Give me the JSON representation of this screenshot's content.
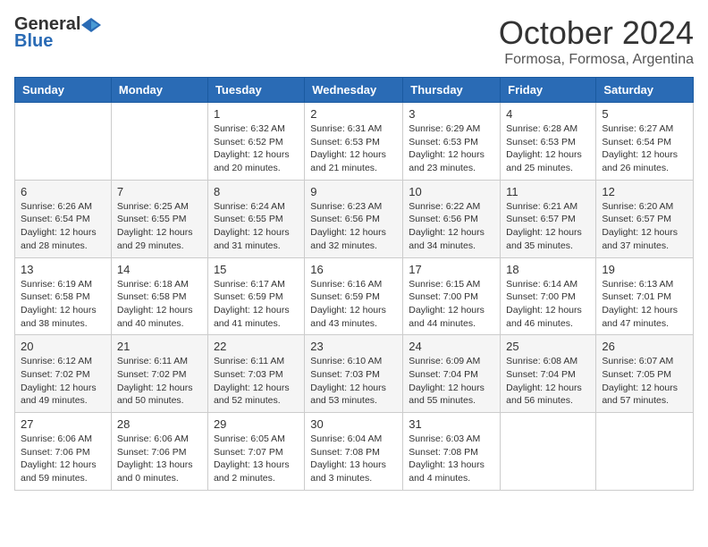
{
  "header": {
    "logo_general": "General",
    "logo_blue": "Blue",
    "month": "October 2024",
    "location": "Formosa, Formosa, Argentina"
  },
  "weekdays": [
    "Sunday",
    "Monday",
    "Tuesday",
    "Wednesday",
    "Thursday",
    "Friday",
    "Saturday"
  ],
  "weeks": [
    [
      {
        "day": "",
        "sunrise": "",
        "sunset": "",
        "daylight": ""
      },
      {
        "day": "",
        "sunrise": "",
        "sunset": "",
        "daylight": ""
      },
      {
        "day": "1",
        "sunrise": "Sunrise: 6:32 AM",
        "sunset": "Sunset: 6:52 PM",
        "daylight": "Daylight: 12 hours and 20 minutes."
      },
      {
        "day": "2",
        "sunrise": "Sunrise: 6:31 AM",
        "sunset": "Sunset: 6:53 PM",
        "daylight": "Daylight: 12 hours and 21 minutes."
      },
      {
        "day": "3",
        "sunrise": "Sunrise: 6:29 AM",
        "sunset": "Sunset: 6:53 PM",
        "daylight": "Daylight: 12 hours and 23 minutes."
      },
      {
        "day": "4",
        "sunrise": "Sunrise: 6:28 AM",
        "sunset": "Sunset: 6:53 PM",
        "daylight": "Daylight: 12 hours and 25 minutes."
      },
      {
        "day": "5",
        "sunrise": "Sunrise: 6:27 AM",
        "sunset": "Sunset: 6:54 PM",
        "daylight": "Daylight: 12 hours and 26 minutes."
      }
    ],
    [
      {
        "day": "6",
        "sunrise": "Sunrise: 6:26 AM",
        "sunset": "Sunset: 6:54 PM",
        "daylight": "Daylight: 12 hours and 28 minutes."
      },
      {
        "day": "7",
        "sunrise": "Sunrise: 6:25 AM",
        "sunset": "Sunset: 6:55 PM",
        "daylight": "Daylight: 12 hours and 29 minutes."
      },
      {
        "day": "8",
        "sunrise": "Sunrise: 6:24 AM",
        "sunset": "Sunset: 6:55 PM",
        "daylight": "Daylight: 12 hours and 31 minutes."
      },
      {
        "day": "9",
        "sunrise": "Sunrise: 6:23 AM",
        "sunset": "Sunset: 6:56 PM",
        "daylight": "Daylight: 12 hours and 32 minutes."
      },
      {
        "day": "10",
        "sunrise": "Sunrise: 6:22 AM",
        "sunset": "Sunset: 6:56 PM",
        "daylight": "Daylight: 12 hours and 34 minutes."
      },
      {
        "day": "11",
        "sunrise": "Sunrise: 6:21 AM",
        "sunset": "Sunset: 6:57 PM",
        "daylight": "Daylight: 12 hours and 35 minutes."
      },
      {
        "day": "12",
        "sunrise": "Sunrise: 6:20 AM",
        "sunset": "Sunset: 6:57 PM",
        "daylight": "Daylight: 12 hours and 37 minutes."
      }
    ],
    [
      {
        "day": "13",
        "sunrise": "Sunrise: 6:19 AM",
        "sunset": "Sunset: 6:58 PM",
        "daylight": "Daylight: 12 hours and 38 minutes."
      },
      {
        "day": "14",
        "sunrise": "Sunrise: 6:18 AM",
        "sunset": "Sunset: 6:58 PM",
        "daylight": "Daylight: 12 hours and 40 minutes."
      },
      {
        "day": "15",
        "sunrise": "Sunrise: 6:17 AM",
        "sunset": "Sunset: 6:59 PM",
        "daylight": "Daylight: 12 hours and 41 minutes."
      },
      {
        "day": "16",
        "sunrise": "Sunrise: 6:16 AM",
        "sunset": "Sunset: 6:59 PM",
        "daylight": "Daylight: 12 hours and 43 minutes."
      },
      {
        "day": "17",
        "sunrise": "Sunrise: 6:15 AM",
        "sunset": "Sunset: 7:00 PM",
        "daylight": "Daylight: 12 hours and 44 minutes."
      },
      {
        "day": "18",
        "sunrise": "Sunrise: 6:14 AM",
        "sunset": "Sunset: 7:00 PM",
        "daylight": "Daylight: 12 hours and 46 minutes."
      },
      {
        "day": "19",
        "sunrise": "Sunrise: 6:13 AM",
        "sunset": "Sunset: 7:01 PM",
        "daylight": "Daylight: 12 hours and 47 minutes."
      }
    ],
    [
      {
        "day": "20",
        "sunrise": "Sunrise: 6:12 AM",
        "sunset": "Sunset: 7:02 PM",
        "daylight": "Daylight: 12 hours and 49 minutes."
      },
      {
        "day": "21",
        "sunrise": "Sunrise: 6:11 AM",
        "sunset": "Sunset: 7:02 PM",
        "daylight": "Daylight: 12 hours and 50 minutes."
      },
      {
        "day": "22",
        "sunrise": "Sunrise: 6:11 AM",
        "sunset": "Sunset: 7:03 PM",
        "daylight": "Daylight: 12 hours and 52 minutes."
      },
      {
        "day": "23",
        "sunrise": "Sunrise: 6:10 AM",
        "sunset": "Sunset: 7:03 PM",
        "daylight": "Daylight: 12 hours and 53 minutes."
      },
      {
        "day": "24",
        "sunrise": "Sunrise: 6:09 AM",
        "sunset": "Sunset: 7:04 PM",
        "daylight": "Daylight: 12 hours and 55 minutes."
      },
      {
        "day": "25",
        "sunrise": "Sunrise: 6:08 AM",
        "sunset": "Sunset: 7:04 PM",
        "daylight": "Daylight: 12 hours and 56 minutes."
      },
      {
        "day": "26",
        "sunrise": "Sunrise: 6:07 AM",
        "sunset": "Sunset: 7:05 PM",
        "daylight": "Daylight: 12 hours and 57 minutes."
      }
    ],
    [
      {
        "day": "27",
        "sunrise": "Sunrise: 6:06 AM",
        "sunset": "Sunset: 7:06 PM",
        "daylight": "Daylight: 12 hours and 59 minutes."
      },
      {
        "day": "28",
        "sunrise": "Sunrise: 6:06 AM",
        "sunset": "Sunset: 7:06 PM",
        "daylight": "Daylight: 13 hours and 0 minutes."
      },
      {
        "day": "29",
        "sunrise": "Sunrise: 6:05 AM",
        "sunset": "Sunset: 7:07 PM",
        "daylight": "Daylight: 13 hours and 2 minutes."
      },
      {
        "day": "30",
        "sunrise": "Sunrise: 6:04 AM",
        "sunset": "Sunset: 7:08 PM",
        "daylight": "Daylight: 13 hours and 3 minutes."
      },
      {
        "day": "31",
        "sunrise": "Sunrise: 6:03 AM",
        "sunset": "Sunset: 7:08 PM",
        "daylight": "Daylight: 13 hours and 4 minutes."
      },
      {
        "day": "",
        "sunrise": "",
        "sunset": "",
        "daylight": ""
      },
      {
        "day": "",
        "sunrise": "",
        "sunset": "",
        "daylight": ""
      }
    ]
  ]
}
